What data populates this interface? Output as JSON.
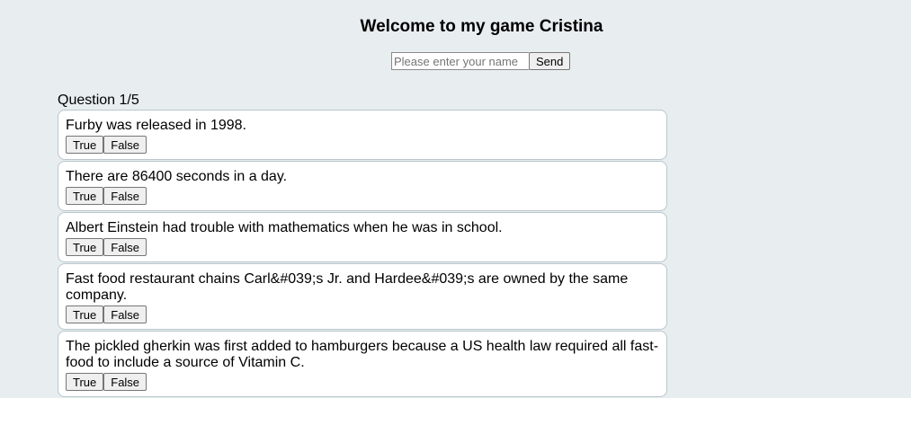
{
  "header": {
    "title": "Welcome to my game Cristina"
  },
  "name_form": {
    "placeholder": "Please enter your name",
    "value": "",
    "send_label": "Send"
  },
  "quiz": {
    "counter": "Question 1/5",
    "true_label": "True",
    "false_label": "False",
    "questions": [
      "Furby was released in 1998.",
      "There are 86400 seconds in a day.",
      "Albert Einstein had trouble with mathematics when he was in school.",
      "Fast food restaurant chains Carl&#039;s Jr. and Hardee&#039;s are owned by the same company.",
      "The pickled gherkin was first added to hamburgers because a US health law required all fast-food to include a source of Vitamin C."
    ]
  }
}
